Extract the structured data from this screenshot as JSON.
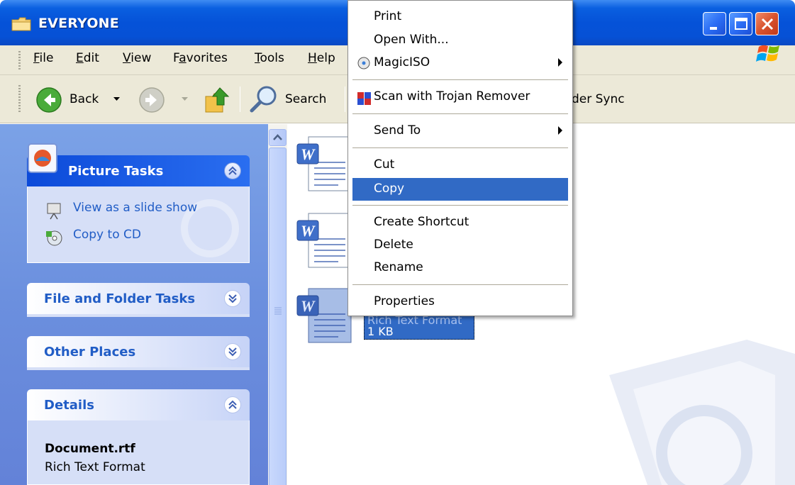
{
  "window": {
    "title": "EVERYONE"
  },
  "menubar": {
    "items": [
      {
        "label": "File",
        "underline": "F"
      },
      {
        "label": "Edit",
        "underline": "E"
      },
      {
        "label": "View",
        "underline": "V"
      },
      {
        "label": "Favorites",
        "underline": "a"
      },
      {
        "label": "Tools",
        "underline": "T"
      },
      {
        "label": "Help",
        "underline": "H"
      }
    ]
  },
  "toolbar": {
    "back_label": "Back",
    "search_label": "Search",
    "folder_sync_partial": "der Sync"
  },
  "leftpane": {
    "picture_tasks": {
      "title": "Picture Tasks",
      "tasks": [
        {
          "label": "View as a slide show",
          "icon": "slideshow-icon"
        },
        {
          "label": "Copy to CD",
          "icon": "copy-to-cd-icon"
        }
      ]
    },
    "file_folder_tasks": {
      "title": "File and Folder Tasks"
    },
    "other_places": {
      "title": "Other Places"
    },
    "details": {
      "title": "Details",
      "filename": "Document.rtf",
      "filetype": "Rich Text Format"
    }
  },
  "content": {
    "selected_file": {
      "type_partial": "Rich Text Format",
      "size": "1 KB"
    }
  },
  "context_menu": {
    "items": [
      {
        "label": "Print"
      },
      {
        "label": "Open With..."
      },
      {
        "label": "MagicISO",
        "submenu": true
      },
      {
        "label": "Scan with Trojan Remover"
      },
      {
        "label": "Send To",
        "submenu": true
      },
      {
        "label": "Cut"
      },
      {
        "label": "Copy",
        "selected": true
      },
      {
        "label": "Create Shortcut"
      },
      {
        "label": "Delete"
      },
      {
        "label": "Rename"
      },
      {
        "label": "Properties"
      }
    ]
  },
  "colors": {
    "titlebar": "#0552d8",
    "selection": "#316ac5",
    "task_link": "#215dc6",
    "leftpane": "#6b8fde"
  }
}
